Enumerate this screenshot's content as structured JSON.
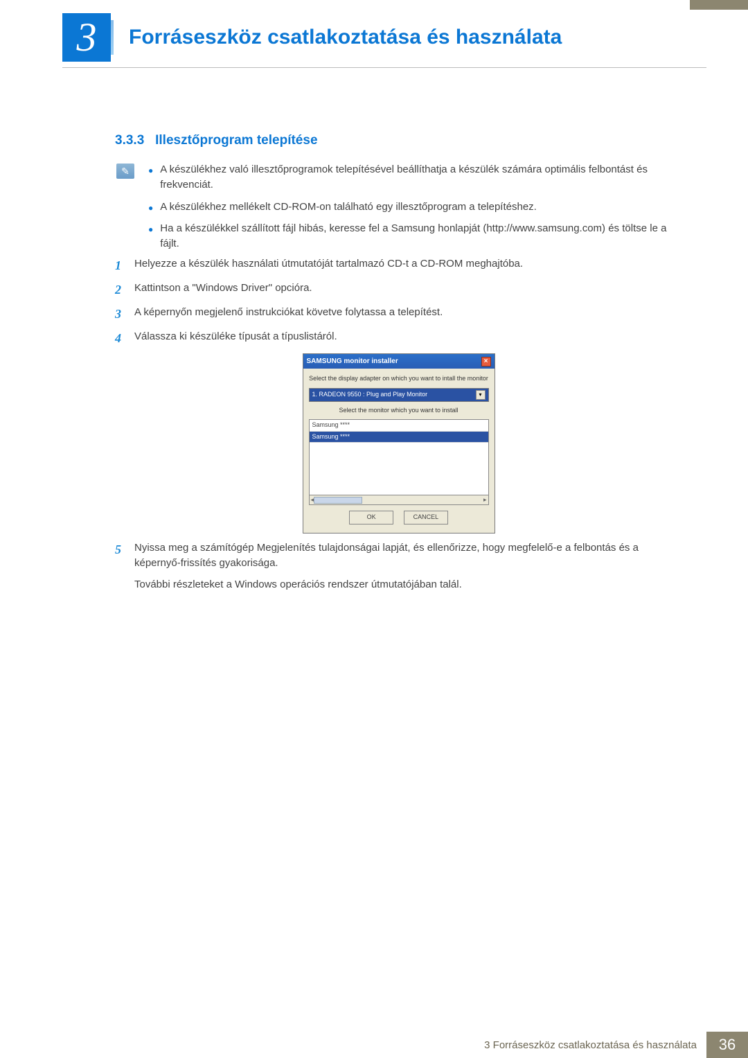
{
  "chapter": {
    "number": "3",
    "title": "Forráseszköz csatlakoztatása és használata"
  },
  "section": {
    "number": "3.3.3",
    "title": "Illesztőprogram telepítése"
  },
  "notes": [
    "A készülékhez való illesztőprogramok telepítésével beállíthatja a készülék számára optimális felbontást és frekvenciát.",
    "A készülékhez mellékelt CD-ROM-on található egy illesztőprogram a telepítéshez.",
    "Ha a készülékkel szállított fájl hibás, keresse fel a Samsung honlapját (http://www.samsung.com) és töltse le a fájlt."
  ],
  "steps": [
    {
      "n": "1",
      "t": "Helyezze a készülék használati útmutatóját tartalmazó CD-t a CD-ROM meghajtóba."
    },
    {
      "n": "2",
      "t": "Kattintson a \"Windows Driver\" opcióra."
    },
    {
      "n": "3",
      "t": "A képernyőn megjelenő instrukciókat követve folytassa a telepítést."
    },
    {
      "n": "4",
      "t": "Válassza ki készüléke típusát a típuslistáról."
    }
  ],
  "step5": {
    "n": "5",
    "t": "Nyissa meg a számítógép Megjelenítés tulajdonságai lapját, és ellenőrizze, hogy megfelelő-e a felbontás és a képernyő-frissítés gyakorisága."
  },
  "step5_extra": "További részleteket a Windows operációs rendszer útmutatójában talál.",
  "dialog": {
    "title": "SAMSUNG monitor installer",
    "instr1": "Select the display adapter on which you want to intall the monitor",
    "adapter": "1. RADEON 9550 : Plug and Play Monitor",
    "instr2": "Select the monitor which you want to install",
    "items": [
      "Samsung ****",
      "Samsung ****"
    ],
    "ok": "OK",
    "cancel": "CANCEL"
  },
  "footer": {
    "label": "3 Forráseszköz csatlakoztatása és használata",
    "page": "36"
  }
}
